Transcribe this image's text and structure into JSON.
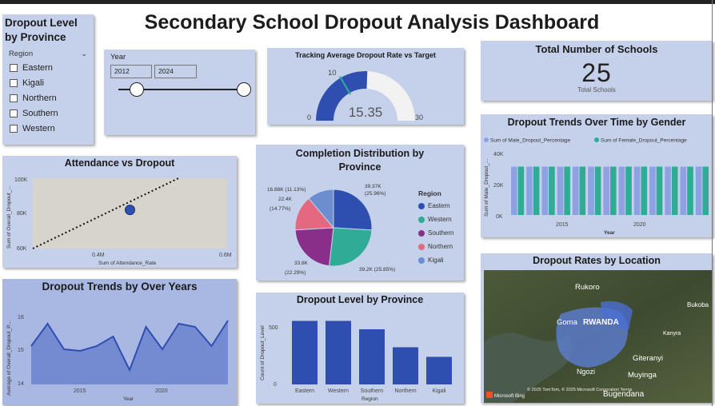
{
  "dashboard_title": "Secondary School Dropout Analysis Dashboard",
  "province_filter": {
    "title": "Dropout Level by Province",
    "field": "Region",
    "options": [
      "Eastern",
      "Kigali",
      "Northern",
      "Southern",
      "Western"
    ]
  },
  "year_slicer": {
    "label": "Year",
    "from": "2012",
    "to": "2024"
  },
  "gauge": {
    "title": "Tracking Average Dropout Rate vs Target",
    "value": 15.35,
    "value_text": "15.35",
    "min": 0,
    "min_text": "0",
    "max": 30,
    "max_text": "30",
    "target": 10,
    "target_text": "10"
  },
  "kpi": {
    "title": "Total Number of Schools",
    "value": "25",
    "caption": "Total Schools"
  },
  "colors": {
    "panel": "#c5d1ea",
    "blue": "#2e4fb0",
    "teal": "#2fab96",
    "purple": "#8a2f89",
    "pink": "#e4687f",
    "light_blue": "#6b8ed1",
    "lavender": "#8ea1e2"
  },
  "gender_chart": {
    "title": "Dropout Trends Over Time by Gender",
    "legend": [
      "Sum of Male_Dropout_Percentage",
      "Sum of Female_Dropout_Percentage"
    ],
    "ylabel": "Sum of Male_Dropout_...",
    "xlabel": "Year",
    "yticks": [
      "40K",
      "20K",
      "0K"
    ],
    "xticks": [
      "2015",
      "2020"
    ]
  },
  "attendance_chart": {
    "title": "Attendance vs Dropout",
    "ylabel": "Sum of Overall_Dropout_...",
    "xlabel": "Sum of Attendance_Rate",
    "yticks": [
      "100K",
      "80K",
      "60K"
    ],
    "xticks": [
      "0.4M",
      "0.6M"
    ]
  },
  "completion_chart": {
    "title": "Completion Distribution by Province",
    "legend_title": "Region",
    "labels": [
      "39.37K (25.96%)",
      "39.2K (25.85%)",
      "33.8K (22.29%)",
      "22.4K (14.77%)",
      "16.88K (11.13%)"
    ],
    "legend": [
      "Eastern",
      "Western",
      "Southern",
      "Northern",
      "Kigali"
    ]
  },
  "location_map": {
    "title": "Dropout Rates by Location",
    "places": [
      "Rukoro",
      "Bukoba",
      "Goma",
      "RWANDA",
      "Kanyra",
      "Giteranyi",
      "Ngozi",
      "Muyinga",
      "Bugendana"
    ],
    "attribution": "Microsoft Bing",
    "credits": "© 2025 TomTom, © 2025 Microsoft Corporation Terms"
  },
  "trend_chart": {
    "title": "Dropout Trends by Over Years",
    "ylabel": "Average of Overall_Dropout_P...",
    "xlabel": "Year",
    "yticks": [
      "16",
      "15",
      "14"
    ],
    "xticks": [
      "2015",
      "2020"
    ]
  },
  "province_bar": {
    "title": "Dropout Level by Province",
    "ylabel": "Count of Dropout_Level",
    "xlabel": "Region",
    "yticks": [
      "500",
      "0"
    ],
    "categories": [
      "Eastern",
      "Western",
      "Southern",
      "Northern",
      "Kigali"
    ]
  },
  "chart_data": [
    {
      "type": "bar",
      "title": "Dropout Trends Over Time by Gender",
      "xlabel": "Year",
      "ylabel": "Sum of Male_Dropout_...",
      "x": [
        2012,
        2013,
        2014,
        2015,
        2016,
        2017,
        2018,
        2019,
        2020,
        2021,
        2022,
        2023,
        2024
      ],
      "series": [
        {
          "name": "Sum of Male_Dropout_Percentage",
          "values": [
            31000,
            31000,
            31000,
            31000,
            31000,
            31000,
            31000,
            31000,
            31000,
            31000,
            31000,
            31000,
            31000
          ]
        },
        {
          "name": "Sum of Female_Dropout_Percentage",
          "values": [
            31000,
            31000,
            31000,
            31000,
            31000,
            31000,
            31000,
            31000,
            31000,
            31000,
            31000,
            31000,
            31000
          ]
        }
      ],
      "ylim": [
        0,
        40000
      ]
    },
    {
      "type": "scatter",
      "title": "Attendance vs Dropout",
      "xlabel": "Sum of Attendance_Rate",
      "ylabel": "Sum of Overall_Dropout_...",
      "points": [
        {
          "x": 400000,
          "y": 82000
        }
      ],
      "trend": [
        {
          "x": 200000,
          "y": 60000
        },
        {
          "x": 500000,
          "y": 100000
        }
      ],
      "xlim": [
        200000,
        600000
      ],
      "ylim": [
        60000,
        100000
      ]
    },
    {
      "type": "pie",
      "title": "Completion Distribution by Province",
      "slices": [
        {
          "name": "Eastern",
          "value": 39370,
          "percent": 25.96
        },
        {
          "name": "Western",
          "value": 39200,
          "percent": 25.85
        },
        {
          "name": "Southern",
          "value": 33800,
          "percent": 22.29
        },
        {
          "name": "Northern",
          "value": 22400,
          "percent": 14.77
        },
        {
          "name": "Kigali",
          "value": 16880,
          "percent": 11.13
        }
      ]
    },
    {
      "type": "area",
      "title": "Dropout Trends by Over Years",
      "xlabel": "Year",
      "ylabel": "Average of Overall_Dropout_P...",
      "x": [
        2012,
        2013,
        2014,
        2015,
        2016,
        2017,
        2018,
        2019,
        2020,
        2021,
        2022,
        2023,
        2024
      ],
      "values": [
        15.2,
        15.9,
        15.1,
        15.05,
        15.2,
        15.5,
        14.45,
        15.8,
        15.1,
        15.9,
        15.8,
        15.2,
        16.0
      ],
      "ylim": [
        14,
        16.5
      ]
    },
    {
      "type": "bar",
      "title": "Dropout Level by Province",
      "xlabel": "Region",
      "ylabel": "Count of Dropout_Level",
      "categories": [
        "Eastern",
        "Western",
        "Southern",
        "Northern",
        "Kigali"
      ],
      "values": [
        530,
        530,
        460,
        310,
        230
      ],
      "ylim": [
        0,
        600
      ]
    }
  ]
}
